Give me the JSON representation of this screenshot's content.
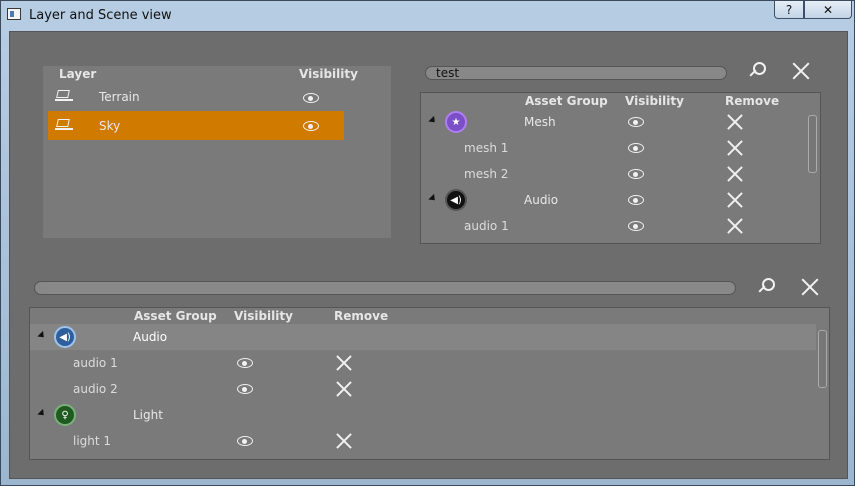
{
  "window": {
    "title": "Layer and Scene view",
    "help_label": "?",
    "close_label": "✕"
  },
  "layers": {
    "header_layer": "Layer",
    "header_visibility": "Visibility",
    "items": [
      {
        "label": "Terrain",
        "selected": false
      },
      {
        "label": "Sky",
        "selected": true
      }
    ],
    "selected_color": "#d07a00"
  },
  "scene_top": {
    "search_value": "test",
    "header_group": "Asset Group",
    "header_visibility": "Visibility",
    "header_remove": "Remove",
    "rows": [
      {
        "label": "Mesh",
        "icon": "mesh-icon"
      },
      {
        "label": "mesh 1"
      },
      {
        "label": "mesh 2"
      },
      {
        "label": "Audio",
        "icon": "speaker-icon"
      },
      {
        "label": "audio 1"
      }
    ]
  },
  "scene_bottom": {
    "search_value": "",
    "header_group": "Asset Group",
    "header_visibility": "Visibility",
    "header_remove": "Remove",
    "rows": [
      {
        "label": "Audio",
        "icon": "speaker-icon"
      },
      {
        "label": "audio 1"
      },
      {
        "label": "audio 2"
      },
      {
        "label": "Light",
        "icon": "lightbulb-icon"
      },
      {
        "label": "light 1"
      }
    ]
  }
}
